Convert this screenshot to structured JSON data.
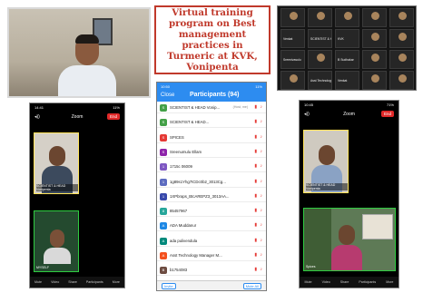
{
  "title_card": {
    "text": "Virtual training program on Best management practices in Turmeric at KVK, Vonipenta"
  },
  "colors": {
    "accent_red": "#c0392b",
    "zoom_blue": "#2d8cf0",
    "end_red": "#e02828"
  },
  "gallery": {
    "cells": [
      {
        "label": "",
        "video": true
      },
      {
        "label": "",
        "video": true
      },
      {
        "label": "",
        "video": true
      },
      {
        "label": "",
        "video": true
      },
      {
        "label": "",
        "video": true
      },
      {
        "label": "Venkat",
        "video": false
      },
      {
        "label": "SCIENTIST & HEAD",
        "video": false
      },
      {
        "label": "KVK",
        "video": false
      },
      {
        "label": "",
        "video": true
      },
      {
        "label": "",
        "video": true
      },
      {
        "label": "Sreenivasulu",
        "video": false
      },
      {
        "label": "",
        "video": true
      },
      {
        "label": "B Sudhakar",
        "video": false
      },
      {
        "label": "",
        "video": true
      },
      {
        "label": "",
        "video": true
      },
      {
        "label": "",
        "video": true
      },
      {
        "label": "Asst Technology",
        "video": false
      },
      {
        "label": "Venkat",
        "video": false
      },
      {
        "label": "",
        "video": true
      },
      {
        "label": "",
        "video": true
      }
    ]
  },
  "phone_left": {
    "status_time": "14:41",
    "status_right": "11%",
    "app_name": "Zoom",
    "end_label": "End",
    "tile1_label": "SCIENTIST & HEAD Vonipenta",
    "tile2_label": "MYSELF"
  },
  "phone_right": {
    "status_time": "10:45",
    "status_right": "71%",
    "app_name": "Zoom",
    "end_label": "End",
    "tile1_label": "SCIENTIST & HEAD Vonipenta",
    "tile2_label": "Spices"
  },
  "toolbar": [
    "Mute",
    "Video",
    "Share",
    "Participants",
    "More"
  ],
  "participants": {
    "status_time": "10:50",
    "status_right": "11%",
    "close_label": "Close",
    "title": "Participants (94)",
    "rows": [
      {
        "initials": "S",
        "name": "SCIENTIST & HEAD Vonip...",
        "color": "#43a047",
        "tag": "(Host, me)"
      },
      {
        "initials": "S",
        "name": "SCIENTIST & HEAD...",
        "color": "#43a047",
        "tag": ""
      },
      {
        "initials": "S",
        "name": "SPICES",
        "color": "#e53935",
        "tag": ""
      },
      {
        "initials": "S",
        "name": "Sreenumulu Ellam",
        "color": "#8e24aa",
        "tag": ""
      },
      {
        "initials": "1",
        "name": "1715c 06009",
        "color": "#7e57c2",
        "tag": ""
      },
      {
        "initials": "1",
        "name": "1g89s1Yhg7tCDc0b2_3013Cg...",
        "color": "#5c6bc0",
        "tag": ""
      },
      {
        "initials": "1",
        "name": "1XPbraps_BtcAREPZ3_3013AA...",
        "color": "#3949ab",
        "tag": ""
      },
      {
        "initials": "8",
        "name": "85457967",
        "color": "#26a69a",
        "tag": ""
      },
      {
        "initials": "A",
        "name": "ADA Muddanur",
        "color": "#1e88e5",
        "tag": ""
      },
      {
        "initials": "A",
        "name": "ada pulivendula",
        "color": "#00897b",
        "tag": ""
      },
      {
        "initials": "A",
        "name": "Asst Technology Manager M...",
        "color": "#f4511e",
        "tag": ""
      },
      {
        "initials": "B",
        "name": "b1754083",
        "color": "#6d4c41",
        "tag": ""
      }
    ],
    "invite_label": "Invite",
    "mute_all_label": "Mute All"
  }
}
